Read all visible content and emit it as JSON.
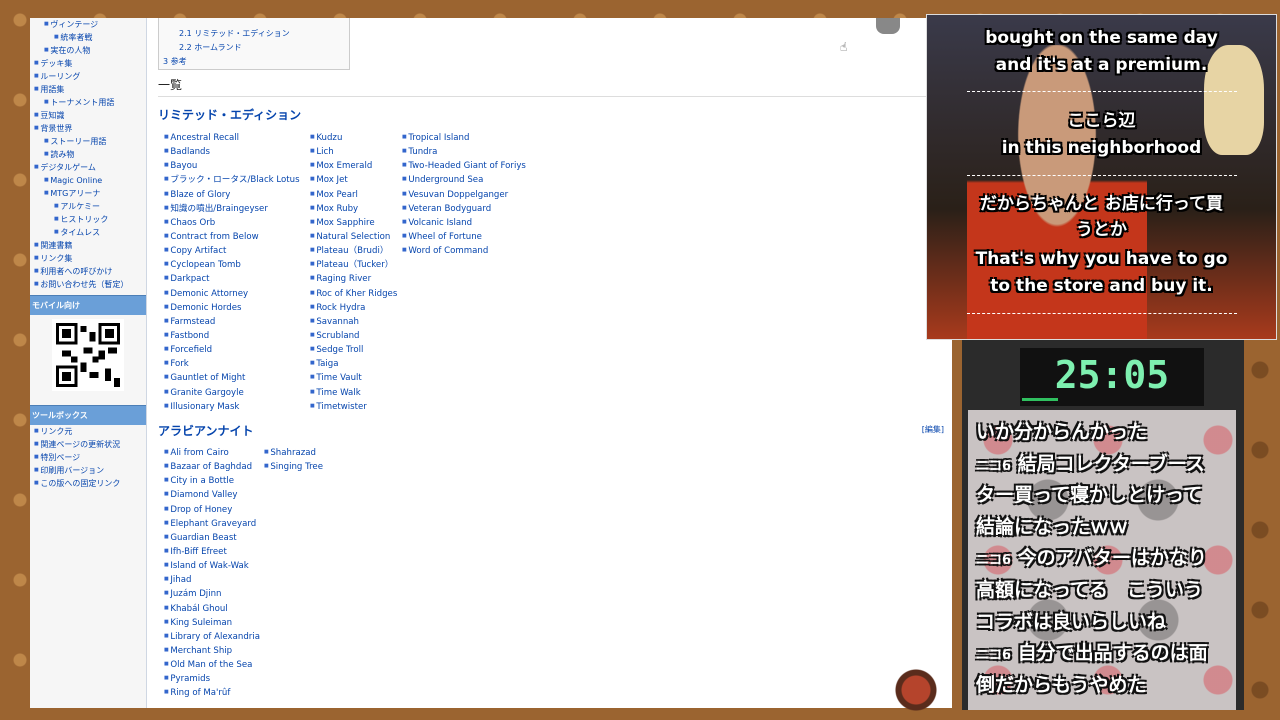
{
  "sidebar": {
    "items": [
      {
        "label": "ヴィンテージ",
        "level": 1
      },
      {
        "label": "統率者戦",
        "level": 2
      },
      {
        "label": "実在の人物",
        "level": 1
      },
      {
        "label": "デッキ集",
        "level": 0
      },
      {
        "label": "ルーリング",
        "level": 0
      },
      {
        "label": "用語集",
        "level": 0
      },
      {
        "label": "トーナメント用語",
        "level": 1
      },
      {
        "label": "豆知識",
        "level": 0
      },
      {
        "label": "背景世界",
        "level": 0
      },
      {
        "label": "ストーリー用語",
        "level": 1
      },
      {
        "label": "読み物",
        "level": 1
      },
      {
        "label": "デジタルゲーム",
        "level": 0
      },
      {
        "label": "Magic Online",
        "level": 1
      },
      {
        "label": "MTGアリーナ",
        "level": 1
      },
      {
        "label": "アルケミー",
        "level": 2
      },
      {
        "label": "ヒストリック",
        "level": 2
      },
      {
        "label": "タイムレス",
        "level": 2
      },
      {
        "label": "関連書籍",
        "level": 0
      },
      {
        "label": "リンク集",
        "level": 0
      },
      {
        "label": "利用者への呼びかけ",
        "level": 0
      },
      {
        "label": "お問い合わせ先（暫定）",
        "level": 0
      }
    ],
    "mobile_heading": "モバイル向け",
    "toolbox_heading": "ツールボックス",
    "toolbox_items": [
      "リンク元",
      "関連ページの更新状況",
      "特別ページ",
      "印刷用バージョン",
      "この版への固定リンク"
    ]
  },
  "toc": {
    "items": [
      "2.1 リミテッド・エディション",
      "2.2 ホームランド",
      "3 参考"
    ]
  },
  "main": {
    "section_title": "一覧",
    "edit_label": "[編集]",
    "limited": {
      "title": "リミテッド・エディション",
      "col1": [
        "Ancestral Recall",
        "Badlands",
        "Bayou",
        "ブラック・ロータス/Black Lotus",
        "Blaze of Glory",
        "知識の噴出/Braingeyser",
        "Chaos Orb",
        "Contract from Below",
        "Copy Artifact",
        "Cyclopean Tomb",
        "Darkpact",
        "Demonic Attorney",
        "Demonic Hordes",
        "Farmstead",
        "Fastbond",
        "Forcefield",
        "Fork",
        "Gauntlet of Might",
        "Granite Gargoyle",
        "Illusionary Mask"
      ],
      "col2": [
        "Kudzu",
        "Lich",
        "Mox Emerald",
        "Mox Jet",
        "Mox Pearl",
        "Mox Ruby",
        "Mox Sapphire",
        "Natural Selection",
        "Plateau（Brudi）",
        "Plateau（Tucker）",
        "Raging River",
        "Roc of Kher Ridges",
        "Rock Hydra",
        "Savannah",
        "Scrubland",
        "Sedge Troll",
        "Taiga",
        "Time Vault",
        "Time Walk",
        "Timetwister"
      ],
      "col3": [
        "Tropical Island",
        "Tundra",
        "Two-Headed Giant of Foriys",
        "Underground Sea",
        "Vesuvan Doppelganger",
        "Veteran Bodyguard",
        "Volcanic Island",
        "Wheel of Fortune",
        "Word of Command"
      ]
    },
    "arabian": {
      "title": "アラビアンナイト",
      "col1": [
        "Ali from Cairo",
        "Bazaar of Baghdad",
        "City in a Bottle",
        "Diamond Valley",
        "Drop of Honey",
        "Elephant Graveyard",
        "Guardian Beast",
        "Ifh-Biff Efreet",
        "Island of Wak-Wak",
        "Jihad",
        "Juzám Djinn",
        "Khabál Ghoul",
        "King Suleiman",
        "Library of Alexandria",
        "Merchant Ship",
        "Old Man of the Sea",
        "Pyramids",
        "Ring of Ma'rûf"
      ],
      "col2": [
        "Shahrazad",
        "Singing Tree"
      ]
    }
  },
  "stream": {
    "subtitles": [
      "bought on the same day",
      "and it's at a premium.",
      "ここら辺",
      "in this neighborhood",
      "だからちゃんと お店に行って買",
      "うとか",
      "That's why you have to go",
      "to the store and buy it."
    ],
    "timer": "25:05",
    "chat": [
      {
        "name": "",
        "text": "いか分からんかった"
      },
      {
        "name": "ニコ6",
        "text": "結局コレクターブース"
      },
      {
        "name": "",
        "text": "ター買って寝かしとけって"
      },
      {
        "name": "",
        "text": "結論になったｗｗ"
      },
      {
        "name": "ニコ6",
        "text": "今のアバターはかなり"
      },
      {
        "name": "",
        "text": "高額になってる　こういう"
      },
      {
        "name": "",
        "text": "コラボは良いらしいね"
      },
      {
        "name": "ニコ6",
        "text": "自分で出品するのは面"
      },
      {
        "name": "",
        "text": "倒だからもうやめた"
      }
    ]
  },
  "colors": {
    "link": "#0645ad",
    "timer": "#7ef0b0",
    "sidebar_head": "#6a9fd8"
  }
}
